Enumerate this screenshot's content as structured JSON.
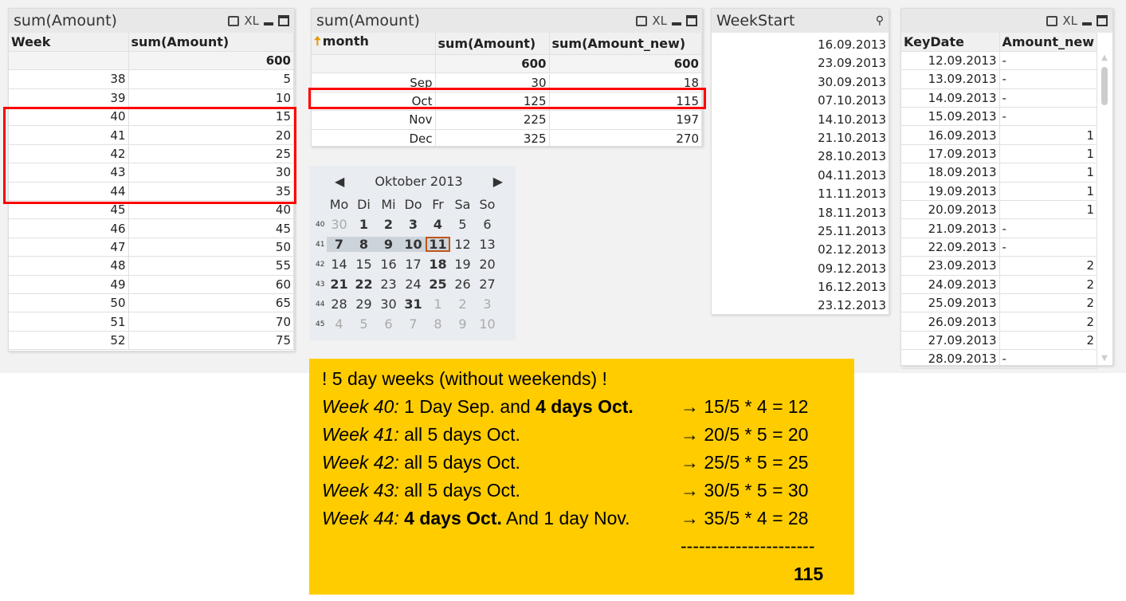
{
  "panel1": {
    "title": "sum(Amount)",
    "headers": [
      "Week",
      "sum(Amount)"
    ],
    "total": "600",
    "rows": [
      [
        "38",
        "5"
      ],
      [
        "39",
        "10"
      ],
      [
        "40",
        "15"
      ],
      [
        "41",
        "20"
      ],
      [
        "42",
        "25"
      ],
      [
        "43",
        "30"
      ],
      [
        "44",
        "35"
      ],
      [
        "45",
        "40"
      ],
      [
        "46",
        "45"
      ],
      [
        "47",
        "50"
      ],
      [
        "48",
        "55"
      ],
      [
        "49",
        "60"
      ],
      [
        "50",
        "65"
      ],
      [
        "51",
        "70"
      ],
      [
        "52",
        "75"
      ]
    ]
  },
  "panel2": {
    "title": "sum(Amount)",
    "headers": [
      "month",
      "sum(Amount)",
      "sum(Amount_new)"
    ],
    "totals": [
      "",
      "600",
      "600"
    ],
    "rows": [
      [
        "Sep",
        "30",
        "18"
      ],
      [
        "Oct",
        "125",
        "115"
      ],
      [
        "Nov",
        "225",
        "197"
      ],
      [
        "Dec",
        "325",
        "270"
      ]
    ]
  },
  "toolbar": {
    "xl": "XL"
  },
  "weekstart": {
    "title": "WeekStart",
    "items": [
      "16.09.2013",
      "23.09.2013",
      "30.09.2013",
      "07.10.2013",
      "14.10.2013",
      "21.10.2013",
      "28.10.2013",
      "04.11.2013",
      "11.11.2013",
      "18.11.2013",
      "25.11.2013",
      "02.12.2013",
      "09.12.2013",
      "16.12.2013",
      "23.12.2013"
    ]
  },
  "panel4": {
    "headers": [
      "KeyDate",
      "Amount_new"
    ],
    "rows": [
      [
        "12.09.2013",
        "-"
      ],
      [
        "13.09.2013",
        "-"
      ],
      [
        "14.09.2013",
        "-"
      ],
      [
        "15.09.2013",
        "-"
      ],
      [
        "16.09.2013",
        "1"
      ],
      [
        "17.09.2013",
        "1"
      ],
      [
        "18.09.2013",
        "1"
      ],
      [
        "19.09.2013",
        "1"
      ],
      [
        "20.09.2013",
        "1"
      ],
      [
        "21.09.2013",
        "-"
      ],
      [
        "22.09.2013",
        "-"
      ],
      [
        "23.09.2013",
        "2"
      ],
      [
        "24.09.2013",
        "2"
      ],
      [
        "25.09.2013",
        "2"
      ],
      [
        "26.09.2013",
        "2"
      ],
      [
        "27.09.2013",
        "2"
      ],
      [
        "28.09.2013",
        "-"
      ]
    ]
  },
  "calendar": {
    "title": "Oktober 2013",
    "days": [
      "Mo",
      "Di",
      "Mi",
      "Do",
      "Fr",
      "Sa",
      "So"
    ],
    "weeks": [
      {
        "wk": "40",
        "d": [
          "30",
          "1",
          "2",
          "3",
          "4",
          "5",
          "6"
        ]
      },
      {
        "wk": "41",
        "d": [
          "7",
          "8",
          "9",
          "10",
          "11",
          "12",
          "13"
        ]
      },
      {
        "wk": "42",
        "d": [
          "14",
          "15",
          "16",
          "17",
          "18",
          "19",
          "20"
        ]
      },
      {
        "wk": "43",
        "d": [
          "21",
          "22",
          "23",
          "24",
          "25",
          "26",
          "27"
        ]
      },
      {
        "wk": "44",
        "d": [
          "28",
          "29",
          "30",
          "31",
          "1",
          "2",
          "3"
        ]
      },
      {
        "wk": "45",
        "d": [
          "4",
          "5",
          "6",
          "7",
          "8",
          "9",
          "10"
        ]
      }
    ],
    "bold": [
      "1",
      "2",
      "3",
      "4",
      "7",
      "8",
      "9",
      "10",
      "11",
      "18",
      "21",
      "22",
      "25",
      "31"
    ],
    "selected_week": "41",
    "today": "11"
  },
  "note": {
    "line0": "! 5 day weeks (without weekends)  !",
    "lines": [
      {
        "w": "Week 40:",
        "a": " 1 Day Sep. and ",
        "b": "4 days Oct.",
        "c": "",
        "r": "→ 15/5 * 4 = 12"
      },
      {
        "w": "Week 41:",
        "a": " all 5 days Oct.",
        "b": "",
        "c": "",
        "r": "→ 20/5 * 5 = 20"
      },
      {
        "w": "Week 42:",
        "a": " all 5 days Oct.",
        "b": "",
        "c": "",
        "r": "→ 25/5 * 5 = 25"
      },
      {
        "w": "Week 43:",
        "a": " all 5 days Oct.",
        "b": "",
        "c": "",
        "r": "→ 30/5 * 5 = 30"
      },
      {
        "w": "Week 44:",
        "a": " ",
        "b": "4 days Oct.",
        "c": " And 1 day Nov.",
        "r": "→ 35/5 * 4 = 28"
      }
    ],
    "separator": "----------------------",
    "total": "115"
  },
  "colors": {
    "highlight": "#ff0000",
    "note_bg": "#ffcc00",
    "today_border": "#c0561a"
  }
}
